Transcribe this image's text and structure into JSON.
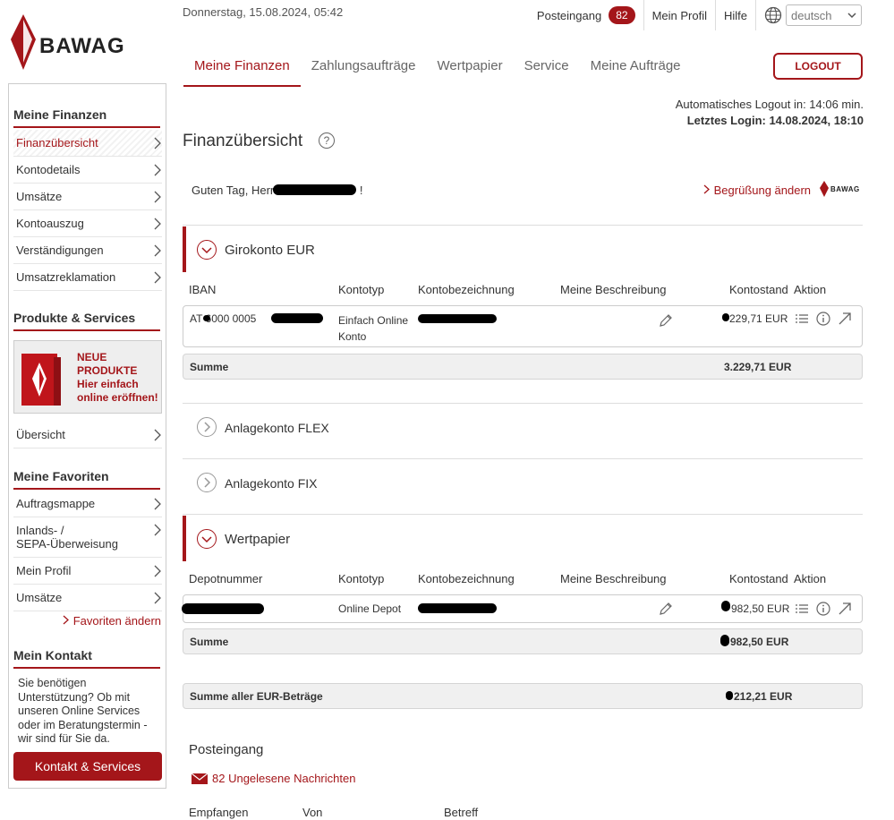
{
  "brand": {
    "name": "BAWAG",
    "mini_name": "BAWAG",
    "color": "#a4161a"
  },
  "header": {
    "datetime": "Donnerstag, 15.08.2024, 05:42",
    "inbox_label": "Posteingang",
    "inbox_count": "82",
    "profile_label": "Mein Profil",
    "help_label": "Hilfe",
    "language": "deutsch",
    "logout_label": "LOGOUT",
    "nav": [
      "Meine Finanzen",
      "Zahlungsaufträge",
      "Wertpapier",
      "Service",
      "Meine Aufträge"
    ]
  },
  "sidebar": {
    "finanzen_head": "Meine Finanzen",
    "finanzen_items": [
      "Finanzübersicht",
      "Kontodetails",
      "Umsätze",
      "Kontoauszug",
      "Verständigungen",
      "Umsatzreklamation"
    ],
    "produkte_head": "Produkte & Services",
    "promo_line1": "NEUE",
    "promo_line2": "PRODUKTE",
    "promo_line3": "Hier einfach",
    "promo_line4": "online eröffnen!",
    "uebersicht": "Übersicht",
    "favoriten_head": "Meine Favoriten",
    "favoriten_items": [
      "Auftragsmappe",
      "Inlands- /",
      "SEPA-Überweisung",
      "Mein Profil",
      "Umsätze"
    ],
    "favoriten_change": "Favoriten ändern",
    "kontakt_head": "Mein Kontakt",
    "kontakt_text": "Sie benötigen Unterstützung? Ob mit unseren Online Services oder im Beratungstermin - wir sind für Sie da.",
    "kontakt_button": "Kontakt & Services"
  },
  "main": {
    "autologout": "Automatisches Logout in: 14:06  min.",
    "lastlogin": "Letztes Login: 14.08.2024, 18:10",
    "title": "Finanzübersicht",
    "help_symbol": "?",
    "greeting_prefix": "Guten Tag, Herr",
    "greeting_suffix": "!",
    "greeting_change": "Begrüßung ändern",
    "giro": {
      "title": "Girokonto EUR",
      "columns": [
        "IBAN",
        "Kontotyp",
        "Kontobezeichnung",
        "Meine Beschreibung",
        "Kontostand",
        "Aktion"
      ],
      "row": {
        "iban": "AT   6000 0005",
        "typ_line1": "Einfach Online",
        "typ_line2": "Konto",
        "stand": "229,71 EUR"
      },
      "sum_label": "Summe",
      "sum_value": "3.229,71 EUR"
    },
    "flex_title": "Anlagekonto FLEX",
    "fix_title": "Anlagekonto FIX",
    "wp": {
      "title": "Wertpapier",
      "columns": [
        "Depotnummer",
        "Kontotyp",
        "Kontobezeichnung",
        "Meine Beschreibung",
        "Kontostand",
        "Aktion"
      ],
      "row": {
        "typ": "Online Depot",
        "stand": "982,50 EUR"
      },
      "sum_label": "Summe",
      "sum_value": "982,50 EUR"
    },
    "total_label": "Summe aller EUR-Beträge",
    "total_value": "212,21 EUR",
    "inbox_title": "Posteingang",
    "inbox_link": "82 Ungelesene Nachrichten",
    "inbox_columns": [
      "Empfangen",
      "Von",
      "Betreff"
    ]
  }
}
